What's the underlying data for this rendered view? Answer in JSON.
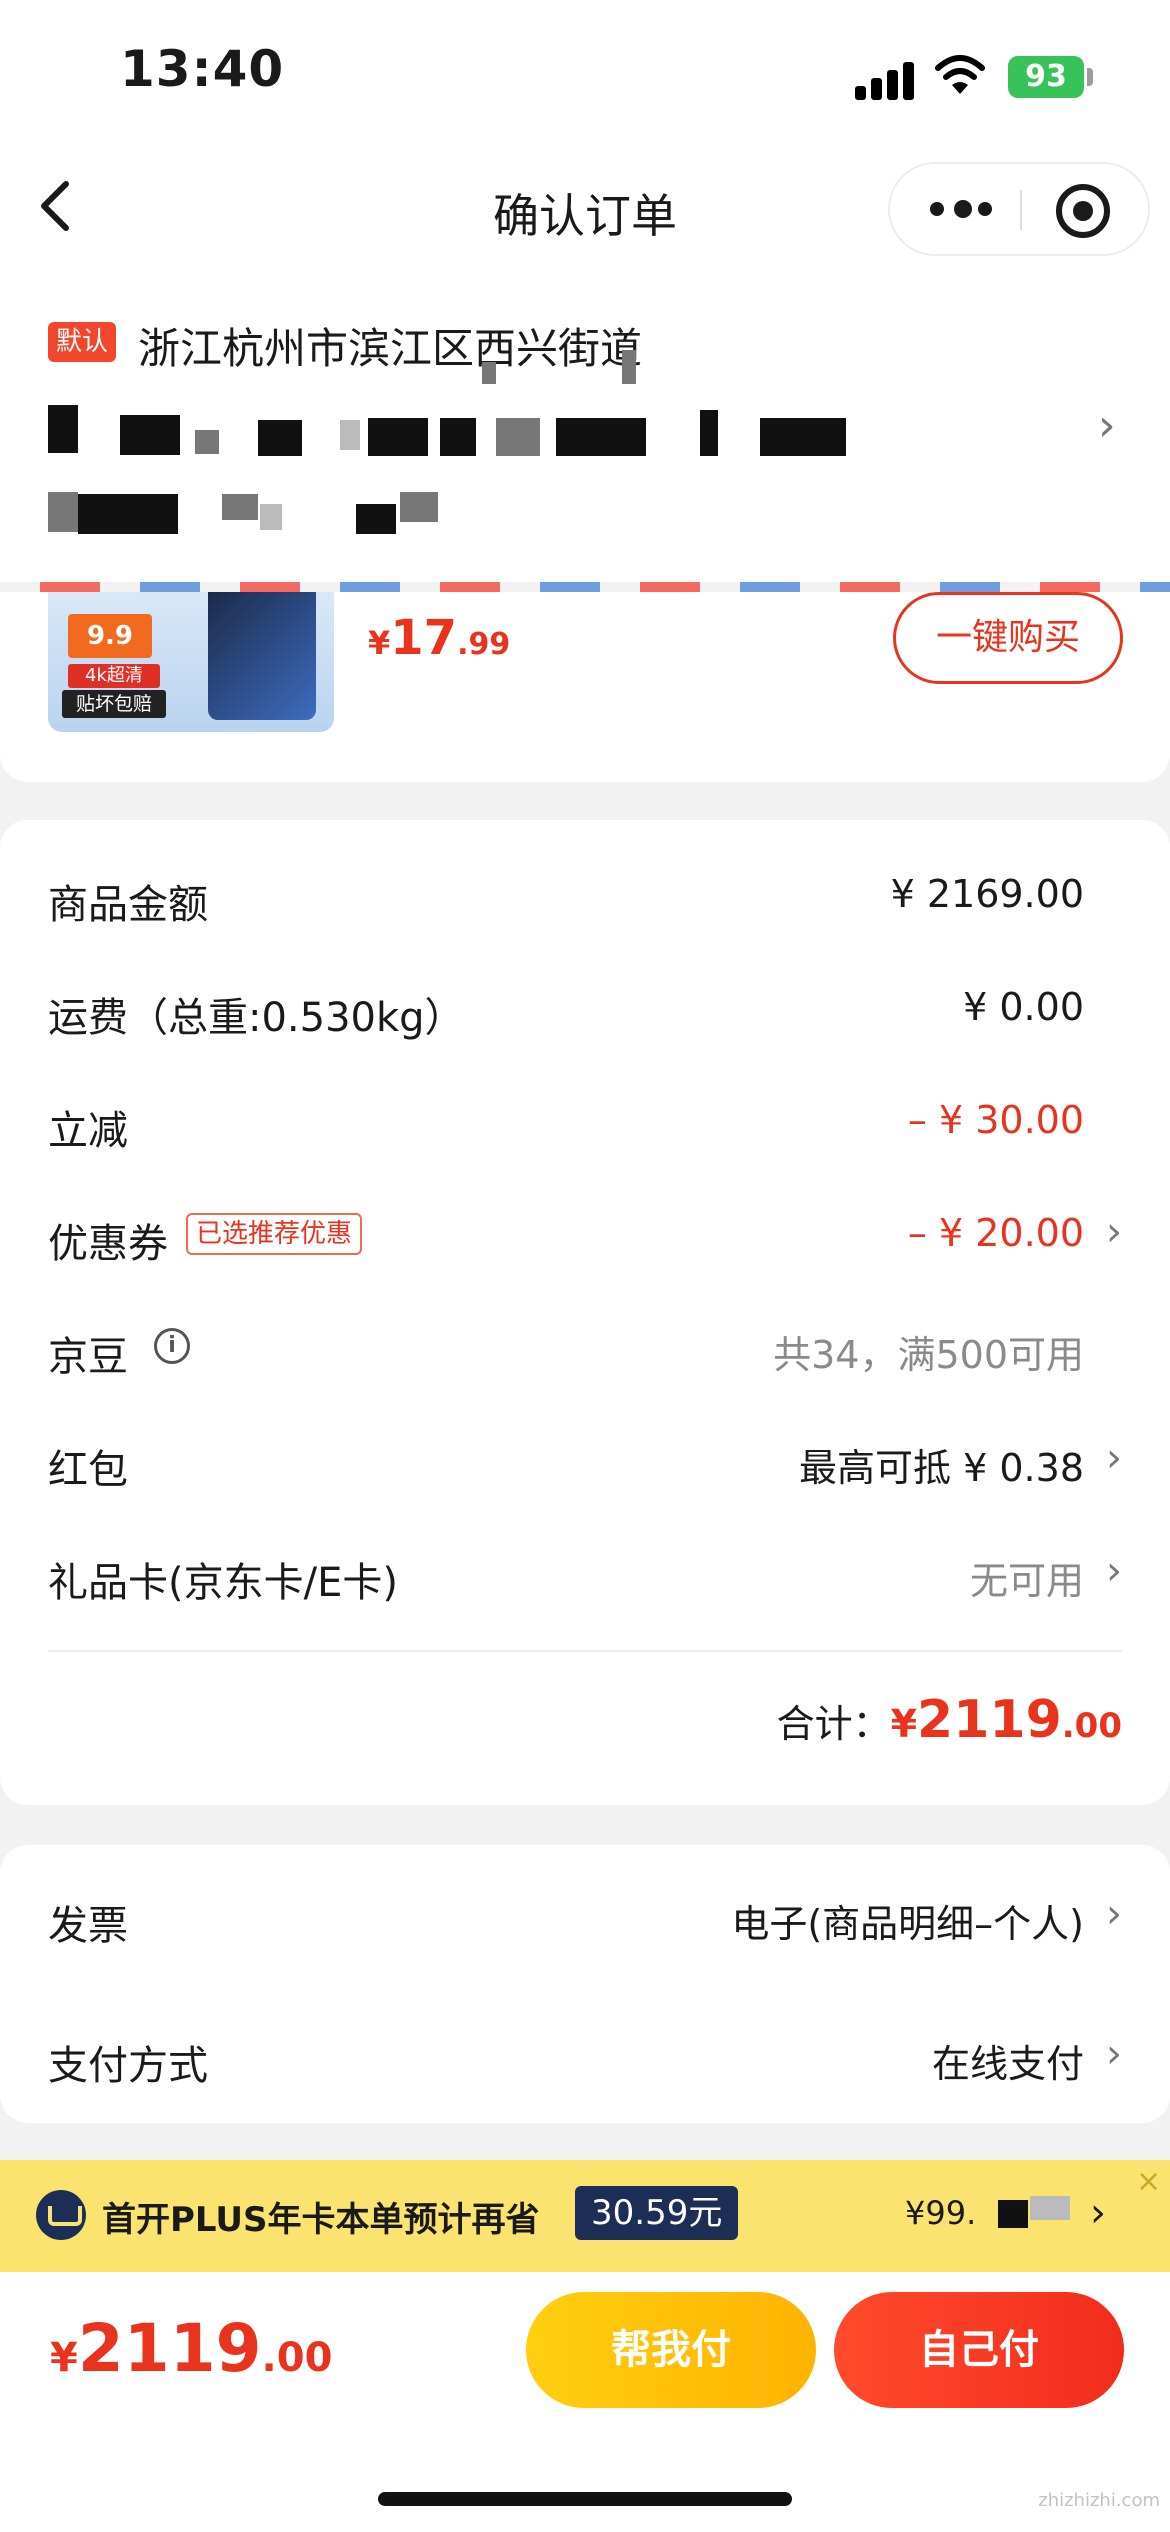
{
  "status_bar": {
    "time": "13:40",
    "battery": "93"
  },
  "nav": {
    "title": "确认订单"
  },
  "address": {
    "tag": "默认",
    "region": "浙江杭州市滨江区西兴街道"
  },
  "recommend": {
    "thumb_price": "9.9",
    "thumb_tag_1": "4k超清",
    "thumb_tag_2": "贴坏包赔",
    "price_currency": "¥",
    "price_int": "17",
    "price_dec": ".99",
    "buy_label": "一键购买"
  },
  "price_details": {
    "rows": [
      {
        "label": "商品金额",
        "value": "¥ 2169.00"
      },
      {
        "label": "运费（总重:0.530kg）",
        "value": "¥ 0.00"
      },
      {
        "label": "立减",
        "value": "– ¥ 30.00"
      },
      {
        "label": "优惠券",
        "tag": "已选推荐优惠",
        "value": "– ¥ 20.00"
      },
      {
        "label": "京豆",
        "value": "共34，满500可用"
      },
      {
        "label": "红包",
        "value": "最高可抵 ¥ 0.38"
      },
      {
        "label": "礼品卡(京东卡/E卡)",
        "value": "无可用"
      }
    ],
    "total_label": "合计：",
    "total_currency": "¥",
    "total_int": "2119",
    "total_dec": ".00"
  },
  "invoice": {
    "rows": [
      {
        "label": "发票",
        "value": "电子(商品明细–个人)"
      },
      {
        "label": "支付方式",
        "value": "在线支付"
      }
    ]
  },
  "plus_banner": {
    "text": "首开PLUS年卡本单预计再省",
    "badge": "30.59元",
    "price": "¥99.",
    "close": "×"
  },
  "bottom_bar": {
    "currency": "¥",
    "total_int": "2119",
    "total_dec": ".00",
    "help_pay_label": "帮我付",
    "self_pay_label": "自己付"
  },
  "watermark": "zhizhizhi.com",
  "colors": {
    "accent_red": "#e8341f",
    "plus_yellow": "#fbe36f",
    "plus_navy": "#1c2e55",
    "battery_green": "#37c35a"
  },
  "icons": [
    "signal-icon",
    "wifi-icon",
    "battery-icon",
    "back-icon",
    "more-icon",
    "target-icon",
    "chevron-right-icon",
    "info-icon",
    "plus-crown-icon",
    "close-icon"
  ]
}
